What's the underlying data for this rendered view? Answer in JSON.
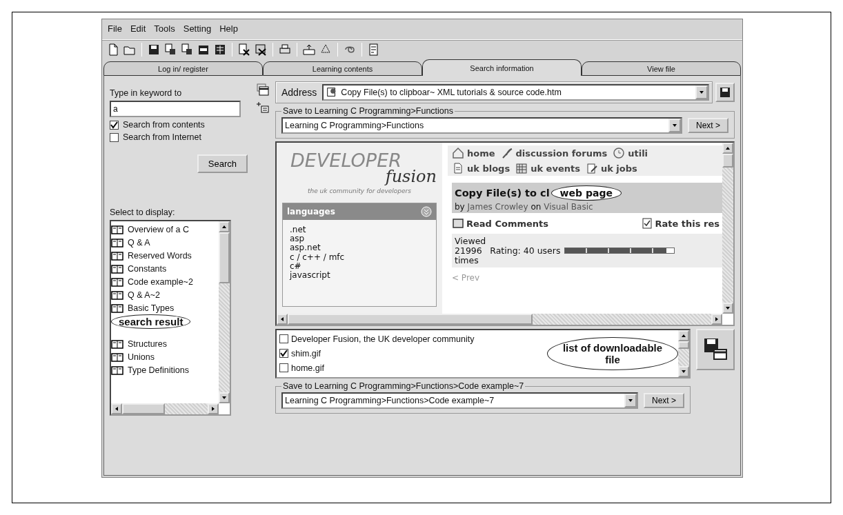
{
  "menu": [
    "File",
    "Edit",
    "Tools",
    "Setting",
    "Help"
  ],
  "tabs": [
    {
      "label": "Log in/ register",
      "selected": false
    },
    {
      "label": "Learning contents",
      "selected": false
    },
    {
      "label": "Search information",
      "selected": true
    },
    {
      "label": "View file",
      "selected": false
    }
  ],
  "search_panel": {
    "prompt": "Type in keyword to",
    "keyword": "a",
    "options": [
      {
        "label": "Search from contents",
        "checked": true
      },
      {
        "label": "Search from Internet",
        "checked": false
      }
    ],
    "button": "Search",
    "list_label": "Select to display:",
    "results_above": [
      "Overview of a C",
      "Q & A",
      "Reserved Words",
      "Constants",
      "Code example~2",
      "Q & A~2",
      "Basic Types"
    ],
    "callout": "search result",
    "results_below": [
      "Structures",
      "Unions",
      "Type Definitions"
    ]
  },
  "address": {
    "label": "Address",
    "value": "Copy File(s) to clipboar~ XML tutorials & source code.htm"
  },
  "save_target": {
    "legend": "Save to Learning C Programming>Functions",
    "value": "Learning C Programming>Functions",
    "button": "Next >"
  },
  "web_page": {
    "logo_top": "DEVELOPER",
    "logo_bottom": "fusion",
    "tagline": "the uk community for developers",
    "panel_title": "languages",
    "languages": [
      ".net",
      "asp",
      "asp.net",
      "c / c++ / mfc",
      "c#",
      "javascript"
    ],
    "nav_rows": [
      [
        "home",
        "discussion forums",
        "utili"
      ],
      [
        "uk blogs",
        "uk events",
        "uk jobs"
      ]
    ],
    "title": "Copy File(s) to cl",
    "callout": "web page",
    "byline": {
      "prefix": "by",
      "author": "James Crowley",
      "joiner": "on",
      "category": "Visual Basic"
    },
    "actions": [
      "Read Comments",
      "Rate this res"
    ],
    "views": [
      "Viewed",
      "21996",
      "times"
    ],
    "rating": {
      "text": "Rating: 40 users",
      "level": 0.93
    },
    "pager": "< Prev"
  },
  "files": {
    "items": [
      {
        "label": "Developer Fusion, the UK developer community",
        "checked": false
      },
      {
        "label": "shim.gif",
        "checked": true
      },
      {
        "label": "home.gif",
        "checked": false
      }
    ],
    "callout": "list of downloadable file"
  },
  "save_target_2": {
    "legend": "Save to Learning C Programming>Functions>Code example~7",
    "value": "Learning C Programming>Functions>Code example~7",
    "button": "Next >"
  }
}
